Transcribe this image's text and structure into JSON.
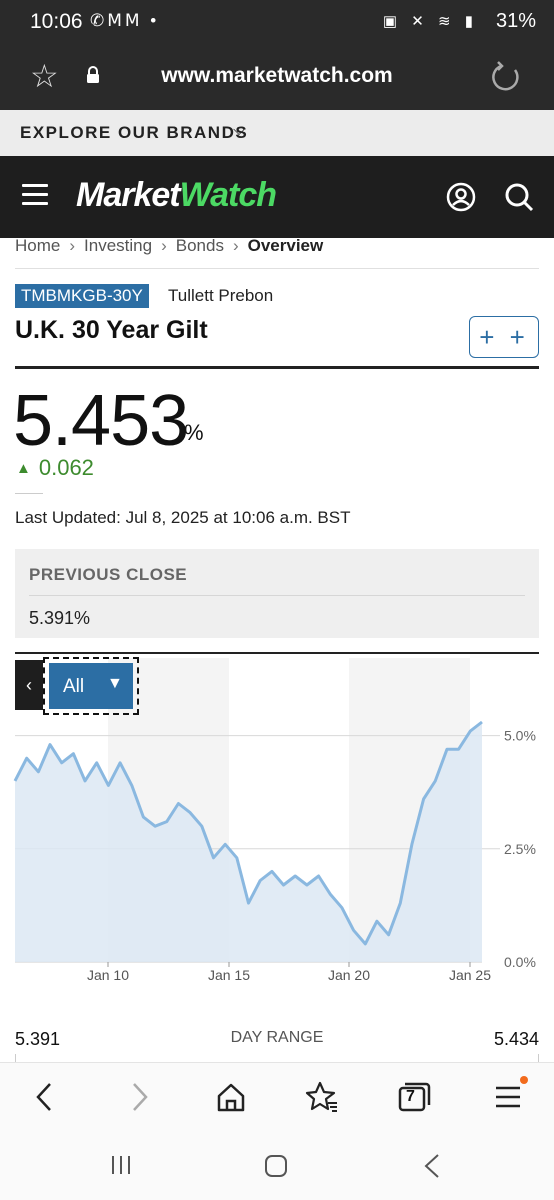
{
  "status_bar": {
    "time": "10:06",
    "notification_icons": [
      "whatsapp-icon",
      "gmail-icon",
      "gmail-icon",
      "dot-icon"
    ],
    "battery": "31%"
  },
  "browser": {
    "url": "www.marketwatch.com",
    "tab_count": "7"
  },
  "explore": {
    "label": "EXPLORE OUR BRANDS"
  },
  "site": {
    "logo_part1": "Market",
    "logo_part2": "Watch",
    "accent": "#4cd964"
  },
  "breadcrumb": [
    "Home",
    "Investing",
    "Bonds",
    "Overview"
  ],
  "quote": {
    "ticker": "TMBMKGB-30Y",
    "exchange": "Tullett Prebon",
    "name": "U.K. 30 Year Gilt",
    "add_label": "+ +",
    "price": "5.453",
    "unit": "%",
    "change": "0.062",
    "change_color": "#3d8b2e",
    "last_updated": "Last Updated: Jul 8, 2025 at 10:06 a.m. BST",
    "previous_close_label": "PREVIOUS CLOSE",
    "previous_close": "5.391%"
  },
  "chart_controls": {
    "range": "All"
  },
  "chart_data": {
    "type": "area",
    "x_ticks": [
      "Jan 10",
      "Jan 15",
      "Jan 20",
      "Jan 25"
    ],
    "y_ticks": [
      "5.0%",
      "2.5%",
      "0.0%"
    ],
    "ylim": [
      0,
      5.3
    ],
    "series": [
      {
        "values": [
          4.0,
          4.5,
          4.2,
          4.8,
          4.4,
          4.6,
          4.0,
          4.4,
          3.9,
          4.4,
          3.9,
          3.2,
          3.0,
          3.1,
          3.5,
          3.3,
          3.0,
          2.3,
          2.6,
          2.3,
          1.3,
          1.8,
          2.0,
          1.7,
          1.9,
          1.7,
          1.9,
          1.5,
          1.2,
          0.7,
          0.4,
          0.9,
          0.6,
          1.3,
          2.6,
          3.6,
          4.0,
          4.7,
          4.7,
          5.1,
          5.3
        ]
      }
    ],
    "line_color": "#8ab8e0",
    "fill_color": "#dce8f3",
    "grid": true,
    "shaded_bands": true
  },
  "day_range": {
    "low": "5.391",
    "label": "DAY RANGE",
    "high": "5.434"
  }
}
